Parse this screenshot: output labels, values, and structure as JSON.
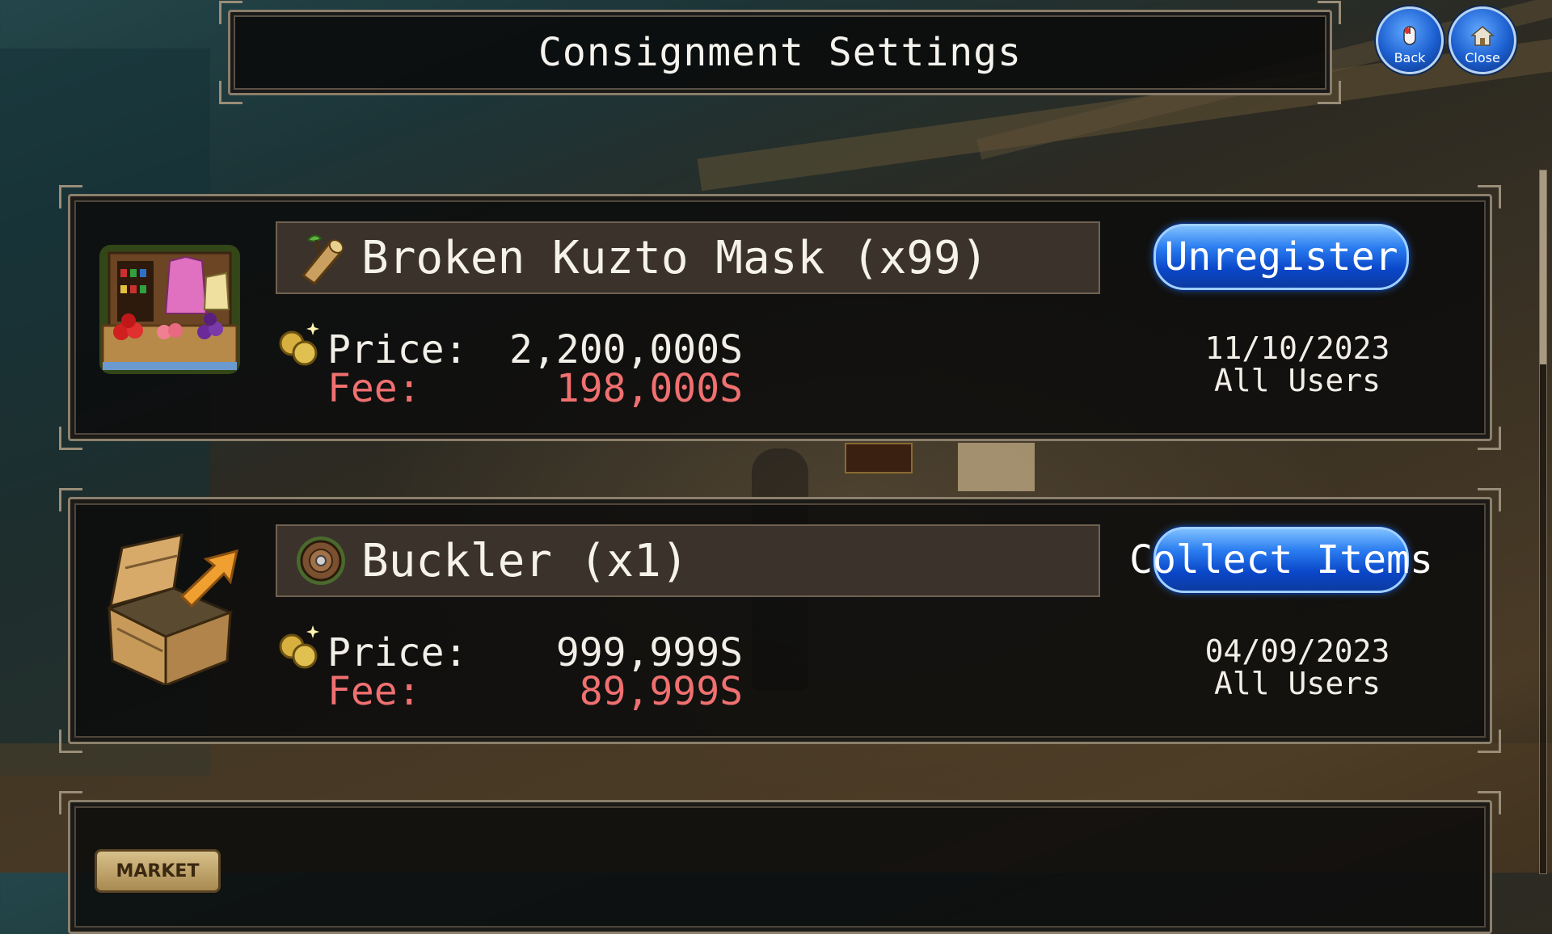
{
  "header": {
    "title": "Consignment Settings",
    "back_label": "Back",
    "close_label": "Close"
  },
  "listings": [
    {
      "item_name": "Broken Kuzto Mask (x99)",
      "action_label": "Unregister",
      "price_label": "Price:",
      "price_value": "2,200,000S",
      "fee_label": "Fee:",
      "fee_value": "198,000S",
      "date": "11/10/2023",
      "audience": "All Users",
      "thumbnail_icon": "market-stall-icon",
      "item_icon": "wooden-log-icon"
    },
    {
      "item_name": "Buckler (x1)",
      "action_label": "Collect Items",
      "price_label": "Price:",
      "price_value": "999,999S",
      "fee_label": "Fee:",
      "fee_value": "89,999S",
      "date": "04/09/2023",
      "audience": "All Users",
      "thumbnail_icon": "crate-arrow-icon",
      "item_icon": "round-shield-icon"
    }
  ],
  "partial_listing": {
    "tag_label": "MARKET"
  },
  "colors": {
    "fee": "#f07070",
    "button_blue": "#1c63e0",
    "panel_border": "#8c806c"
  }
}
